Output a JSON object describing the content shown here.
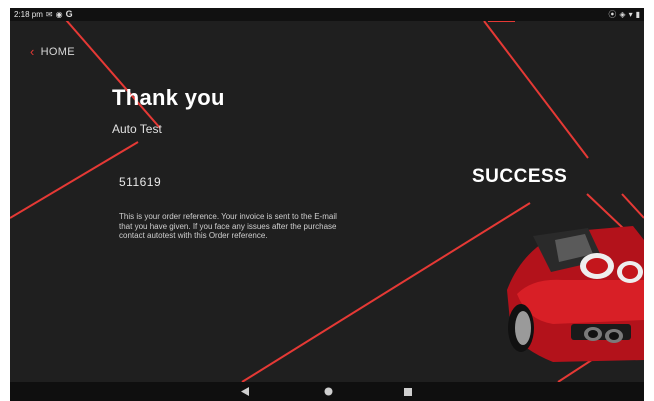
{
  "status_bar": {
    "time": "2:18 pm",
    "left_icons": [
      "mail-icon",
      "sync-icon",
      "google-icon"
    ],
    "right_icons": [
      "location-icon",
      "vibrate-icon",
      "wifi-icon",
      "battery-icon"
    ]
  },
  "header": {
    "home_label": "HOME"
  },
  "main": {
    "title": "Thank you",
    "customer_name": "Auto Test",
    "order_reference": "511619",
    "description": "This is your order reference. Your invoice is sent to the E-mail that you have given. If you face any issues after the purchase contact autotest with this Order reference."
  },
  "banner": {
    "success_label": "SUCCESS"
  },
  "nav_bar": {
    "buttons": [
      "back-icon",
      "home-icon",
      "recents-icon"
    ]
  },
  "colors": {
    "background": "#1f1f1f",
    "accent": "#e53935",
    "text": "#ffffff"
  }
}
